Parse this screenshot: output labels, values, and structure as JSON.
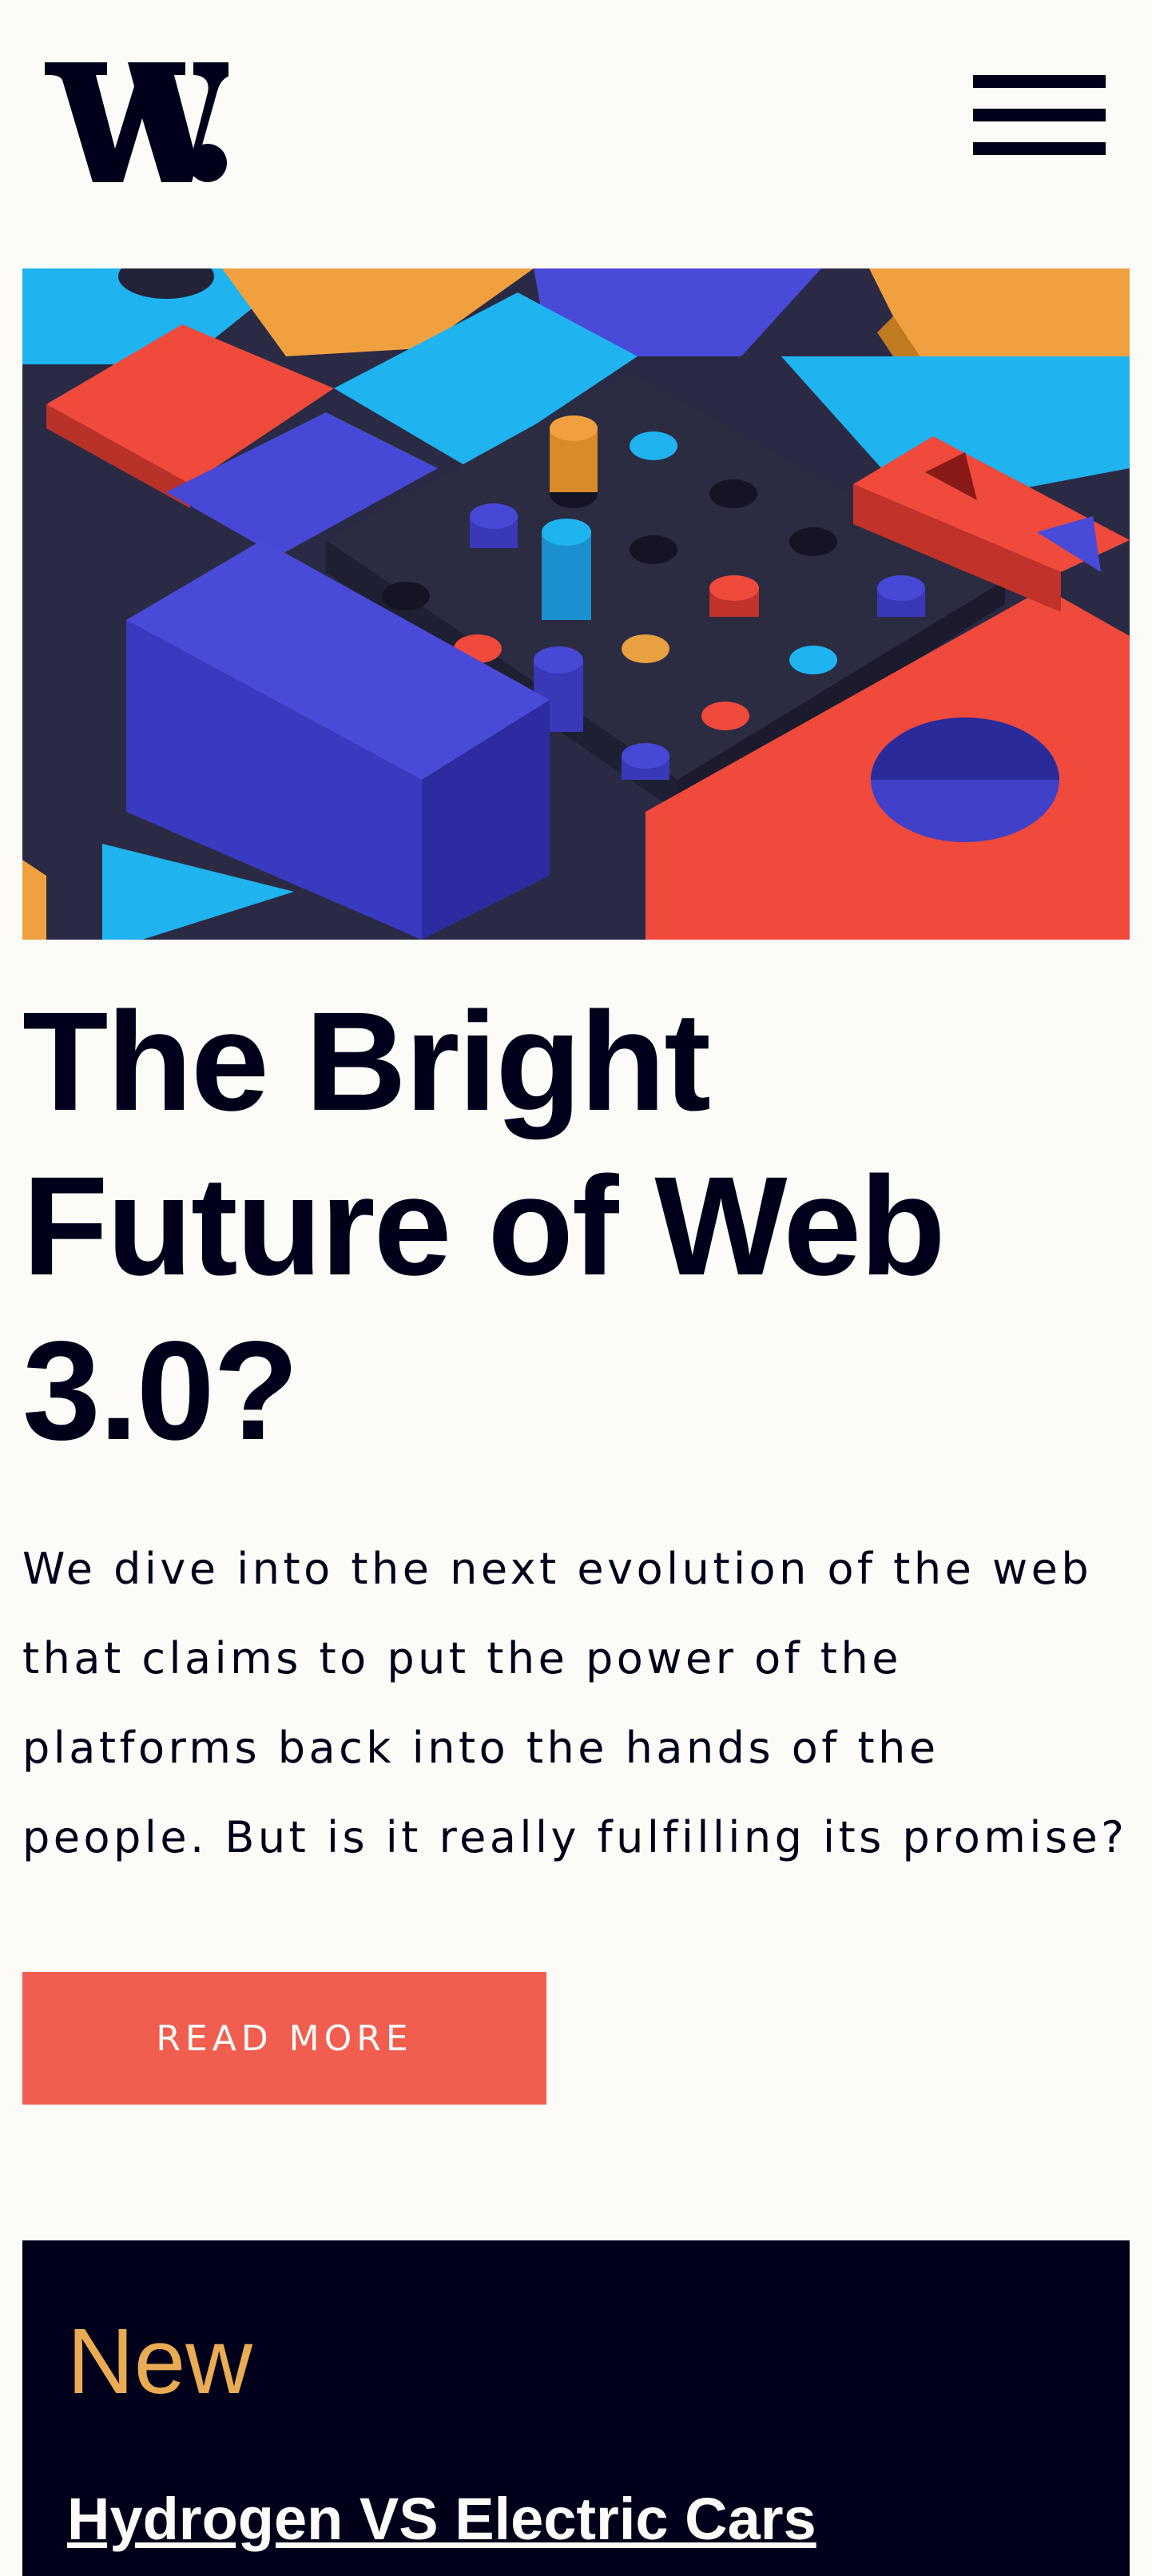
{
  "header": {
    "logo_text": "W.",
    "menu_icon": "hamburger-menu-icon"
  },
  "hero": {
    "image_subject": "abstract 3D colorful blocks and pegs illustration",
    "title": "The Bright Future of Web 3.0?",
    "description": "We dive into the next evolution of the web that claims to put the power of the platforms back into the hands of the people. But is it really fulfilling its promise?",
    "button_label": "READ MORE"
  },
  "new_section": {
    "heading": "New",
    "items": [
      {
        "title": "Hydrogen VS Electric Cars"
      }
    ]
  },
  "colors": {
    "background": "#fdfbf7",
    "text": "#00001a",
    "accent_button": "#f15e50",
    "panel_background": "#00001a",
    "panel_heading": "#e9ab53",
    "panel_text": "#fdfbf7"
  }
}
